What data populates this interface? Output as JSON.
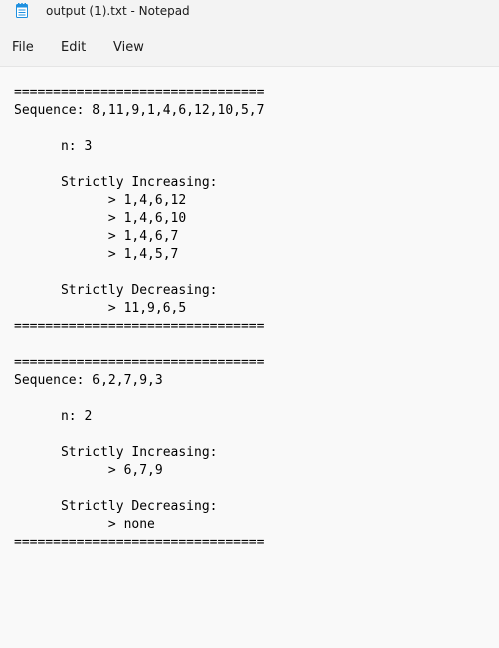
{
  "window": {
    "title": "output (1).txt - Notepad"
  },
  "menu": {
    "file": "File",
    "edit": "Edit",
    "view": "View"
  },
  "editor": {
    "content": "================================\nSequence: 8,11,9,1,4,6,12,10,5,7\n\n      n: 3\n\n      Strictly Increasing:\n            > 1,4,6,12\n            > 1,4,6,10\n            > 1,4,6,7\n            > 1,4,5,7\n\n      Strictly Decreasing:\n            > 11,9,6,5\n================================\n\n================================\nSequence: 6,2,7,9,3\n\n      n: 2\n\n      Strictly Increasing:\n            > 6,7,9\n\n      Strictly Decreasing:\n            > none\n================================"
  },
  "colors": {
    "background": "#f9f9f9",
    "chrome": "#f3f3f3",
    "icon_accent": "#1e90e0"
  },
  "icons": {
    "app": "notepad-icon"
  }
}
